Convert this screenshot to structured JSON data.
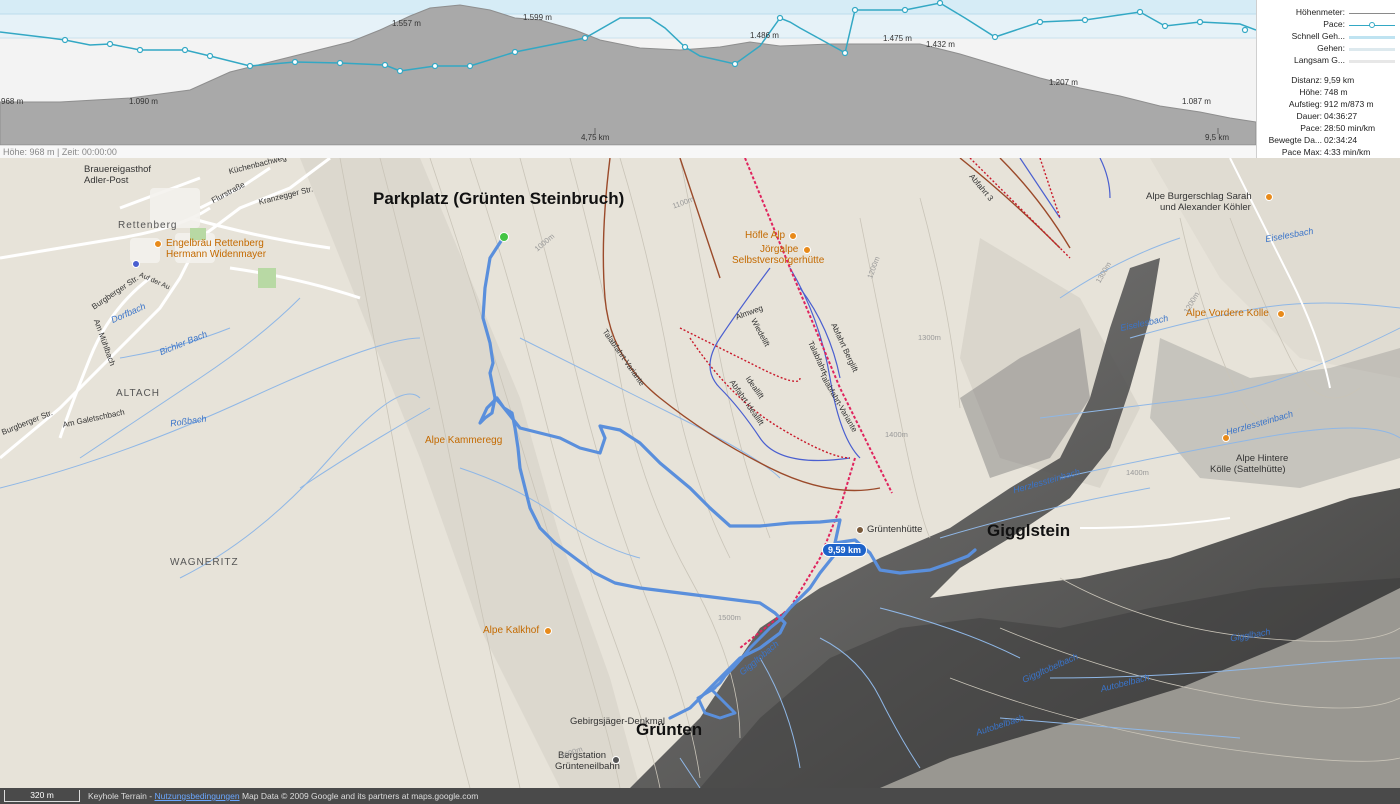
{
  "profile": {
    "elevation_labels": [
      "968 m",
      "1.090 m",
      "1.557 m",
      "1.599 m",
      "1.486 m",
      "1.475 m",
      "1.432 m",
      "1.207 m",
      "1.087 m"
    ],
    "distance_labels": [
      "4,75 km",
      "9,5 km"
    ],
    "status": "Höhe: 968 m | Zeit: 00:00:00",
    "colors": {
      "elevation_fill": "#a9a9a9",
      "pace_line": "#33a8c4",
      "band_top": "#d6ecf6",
      "band_mid": "#e6f2f8"
    }
  },
  "legend": [
    {
      "label": "Höhenmeter:",
      "swatch": "elevation"
    },
    {
      "label": "Pace:",
      "swatch": "pace"
    },
    {
      "label": "Schnell Geh...",
      "swatch": "fast"
    },
    {
      "label": "Gehen:",
      "swatch": "walk"
    },
    {
      "label": "Langsam G...",
      "swatch": "slow"
    }
  ],
  "stats": [
    {
      "key": "Distanz:",
      "value": "9,59 km"
    },
    {
      "key": "Höhe:",
      "value": "748 m"
    },
    {
      "key": "Aufstieg:",
      "value": "912 m/873 m"
    },
    {
      "key": "Dauer:",
      "value": "04:36:27"
    },
    {
      "key": "Pace:",
      "value": "28:50 min/km"
    },
    {
      "key": "Bewegte Da...",
      "value": "02:34:24"
    },
    {
      "key": "Pace Max:",
      "value": "4:33 min/km"
    }
  ],
  "map": {
    "headline_labels": {
      "parkplatz": "Parkplatz (Grünten Steinbruch)",
      "gigglstein": "Gigglstein",
      "gruenten": "Grünten"
    },
    "places": {
      "rettenberg": "Rettenberg",
      "altach": "ALTACH",
      "wagneritz": "WAGNERITZ"
    },
    "pois": {
      "adler_post": "Brauereigasthof\nAdler-Post",
      "engelbraeu_1": "Engelbräu Rettenberg",
      "engelbraeu_2": "Hermann Widenmayer",
      "hoefle": "Höfle Alp",
      "joergalpe_1": "Jörgalpe",
      "joergalpe_2": "Selbstversorgerhütte",
      "burgerschlag_1": "Alpe Burgerschlag Sarah",
      "burgerschlag_2": "und Alexander Köhler",
      "vordere_koelle": "Alpe Vordere Kölle",
      "hintere_koelle_1": "Alpe Hintere",
      "hintere_koelle_2": "Kölle (Sattelhütte)",
      "kammeregg": "Alpe Kammeregg",
      "kalkhof": "Alpe Kalkhof",
      "gruentenhuette": "Grüntenhütte",
      "gebirgsjaeger": "Gebirgsjäger-Denkmal",
      "bergstation_1": "Bergstation",
      "bergstation_2": "Grünteneilbahn"
    },
    "streets": {
      "kuechenbachweg": "Küchenbachweg",
      "flurstrasse": "Flurstraße",
      "kranzegger": "Kranzegger Str.",
      "burgberger": "Burgberger Str.",
      "burgberger2": "Burgberger Str.",
      "am_muehlbach": "Am Mühlbach",
      "am_galetschbach": "Am Galetschbach",
      "auf_der_au": "Auf der Au"
    },
    "streams": {
      "dorfbach": "Dorfbach",
      "bichler_bach": "Bichler Bach",
      "rossbach": "Roßbach",
      "eiselesbach": "Eiselesbach",
      "eiselesbach2": "Eiselesbach",
      "herzlessteinbach": "Herzlessteinbach",
      "gigglbach": "Gigglbach",
      "autobelbach": "Autobelbach",
      "autobelbach2": "Autobelbach",
      "giggltobelbach": "Giggltobelbach",
      "giggltobach": "Giggltobach"
    },
    "pistes": {
      "talabfahrt_variante": "Talabfahrt-Variante",
      "abfahrt_idealift": "Abfahrt Ideallift",
      "ideallift": "Ideallift",
      "almweg": "Almweg",
      "wiedelift": "Wiedelift",
      "abfahrt_berglift": "Abfahrt Berglift",
      "talabfahrt": "Talabfahrt",
      "talabfahrt_variante2": "Talabfahrt-Variante",
      "abfahrt3": "Abfahrt 3"
    },
    "contours": [
      "1100m",
      "1200m",
      "1300m",
      "1400m",
      "1500m",
      "1600m",
      "1000m",
      "1300m",
      "1400m",
      "1200m"
    ],
    "route_distance_badge": "9,59 km",
    "colors": {
      "route": "#5a8fdc",
      "lift": "#e0245e",
      "piste_red": "#c9192a",
      "piste_blue": "#4a5fd0",
      "ski_route_brown": "#9b4a2a",
      "poi": "#c46a00"
    }
  },
  "footer": {
    "scale": "320 m",
    "layer": "Keyhole Terrain -",
    "terms_link": "Nutzungsbedingungen",
    "copyright": "Map Data © 2009 Google and its partners at maps.google.com"
  }
}
